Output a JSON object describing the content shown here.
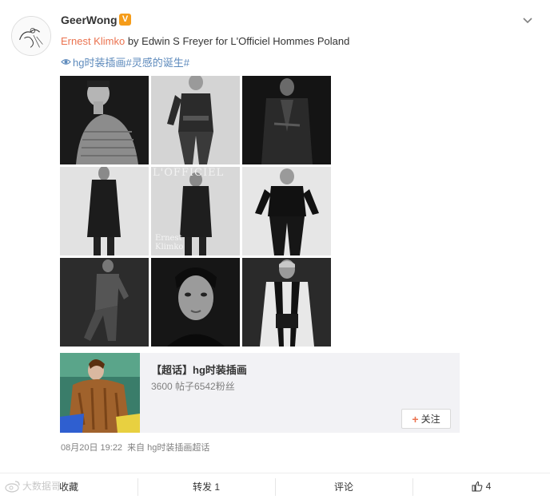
{
  "post": {
    "username": "GeerWong",
    "verified_badge": "V",
    "text_mention": "Ernest Klimko",
    "text_rest": " by Edwin S Freyer for L'Officiel Hommes Poland",
    "hashtags": "hg时装插画#灵感的诞生#",
    "photos": [
      {
        "icon": "photo-knit-sweater"
      },
      {
        "icon": "photo-leather-jacket"
      },
      {
        "icon": "photo-dark-coat"
      },
      {
        "icon": "photo-long-coat"
      },
      {
        "icon": "photo-magazine-cover",
        "cover_text": "L'OFFICIEL",
        "cover_name": "Ernest Klimko"
      },
      {
        "icon": "photo-black-outfit"
      },
      {
        "icon": "photo-crouching-pose"
      },
      {
        "icon": "photo-portrait"
      },
      {
        "icon": "photo-harness-shirt"
      }
    ],
    "topic_card": {
      "title": "【超话】hg时装插画",
      "stats": "3600 帖子6542粉丝",
      "follow_plus": "+",
      "follow_label": "关注"
    },
    "timestamp": "08月20日 19:22",
    "source": "来自 hg时装插画超话"
  },
  "actions": {
    "favorite": "收藏",
    "repost": "转发 1",
    "comment": "评论",
    "like_count": "4"
  },
  "watermark": "大数据哥"
}
